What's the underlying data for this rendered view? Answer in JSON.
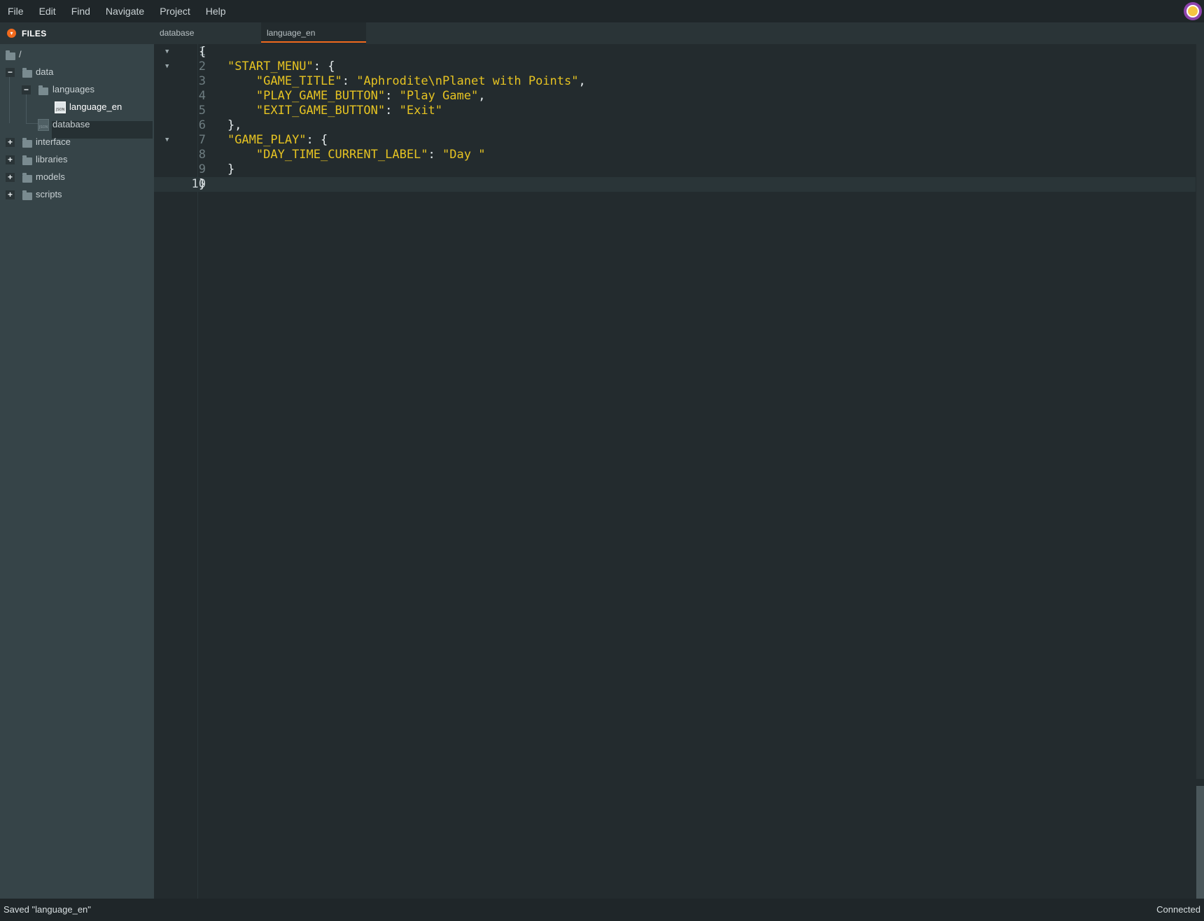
{
  "menubar": {
    "items": [
      "File",
      "Edit",
      "Find",
      "Navigate",
      "Project",
      "Help"
    ]
  },
  "sidebar": {
    "header": "FILES",
    "root": "/",
    "tree": {
      "data": "data",
      "languages": "languages",
      "language_en": "language_en",
      "database": "database",
      "interface": "interface",
      "libraries": "libraries",
      "models": "models",
      "scripts": "scripts"
    },
    "toggle_collapse": "−",
    "toggle_expand": "+"
  },
  "tabs": [
    {
      "label": "database",
      "active": false
    },
    {
      "label": "language_en",
      "active": true
    }
  ],
  "editor": {
    "current_line": 10,
    "lines": [
      {
        "n": "1",
        "text": "{"
      },
      {
        "n": "2",
        "text": "    \"START_MENU\": {"
      },
      {
        "n": "3",
        "text": "        \"GAME_TITLE\": \"Aphrodite\\nPlanet with Points\","
      },
      {
        "n": "4",
        "text": "        \"PLAY_GAME_BUTTON\": \"Play Game\","
      },
      {
        "n": "5",
        "text": "        \"EXIT_GAME_BUTTON\": \"Exit\""
      },
      {
        "n": "6",
        "text": "    },"
      },
      {
        "n": "7",
        "text": "    \"GAME_PLAY\": {"
      },
      {
        "n": "8",
        "text": "        \"DAY_TIME_CURRENT_LABEL\": \"Day \""
      },
      {
        "n": "9",
        "text": "    }"
      },
      {
        "n": "10",
        "text": "}"
      }
    ]
  },
  "statusbar": {
    "message": "Saved \"language_en\"",
    "connection": "Connected"
  },
  "colors": {
    "accent": "#f06a1d",
    "string": "#e6c322",
    "background": "#232b2e",
    "sidebar": "#364448"
  },
  "icons": {
    "files_header": "files-dot-icon",
    "folder": "folder-icon",
    "file": "json-file-icon",
    "fold": "fold-arrow-icon",
    "avatar": "user-avatar-icon"
  }
}
